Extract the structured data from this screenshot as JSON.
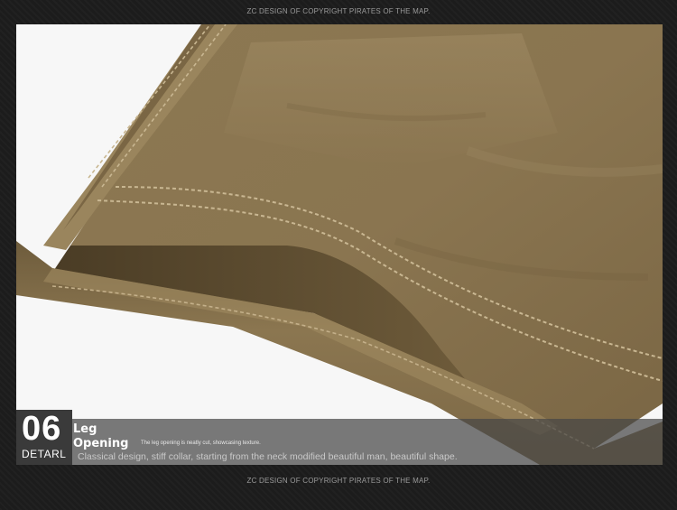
{
  "credits": {
    "top": "ZC DESIGN OF COPYRIGHT PIRATES OF THE MAP.",
    "bottom": "ZC DESIGN OF COPYRIGHT PIRATES OF THE MAP."
  },
  "detail": {
    "number": "06",
    "label": "DETARL",
    "title": "Leg Opening",
    "caption_small": "The leg opening is neatly cut, showcasing texture.",
    "caption": "Classical design, stiff collar, starting from the neck modified beautiful man, beautiful shape."
  },
  "colors": {
    "fabric": "#8a7550",
    "fabric_dark": "#5e4d31",
    "stitch": "#c9b792",
    "background": "#1c1c1c",
    "overlay": "#464646"
  }
}
